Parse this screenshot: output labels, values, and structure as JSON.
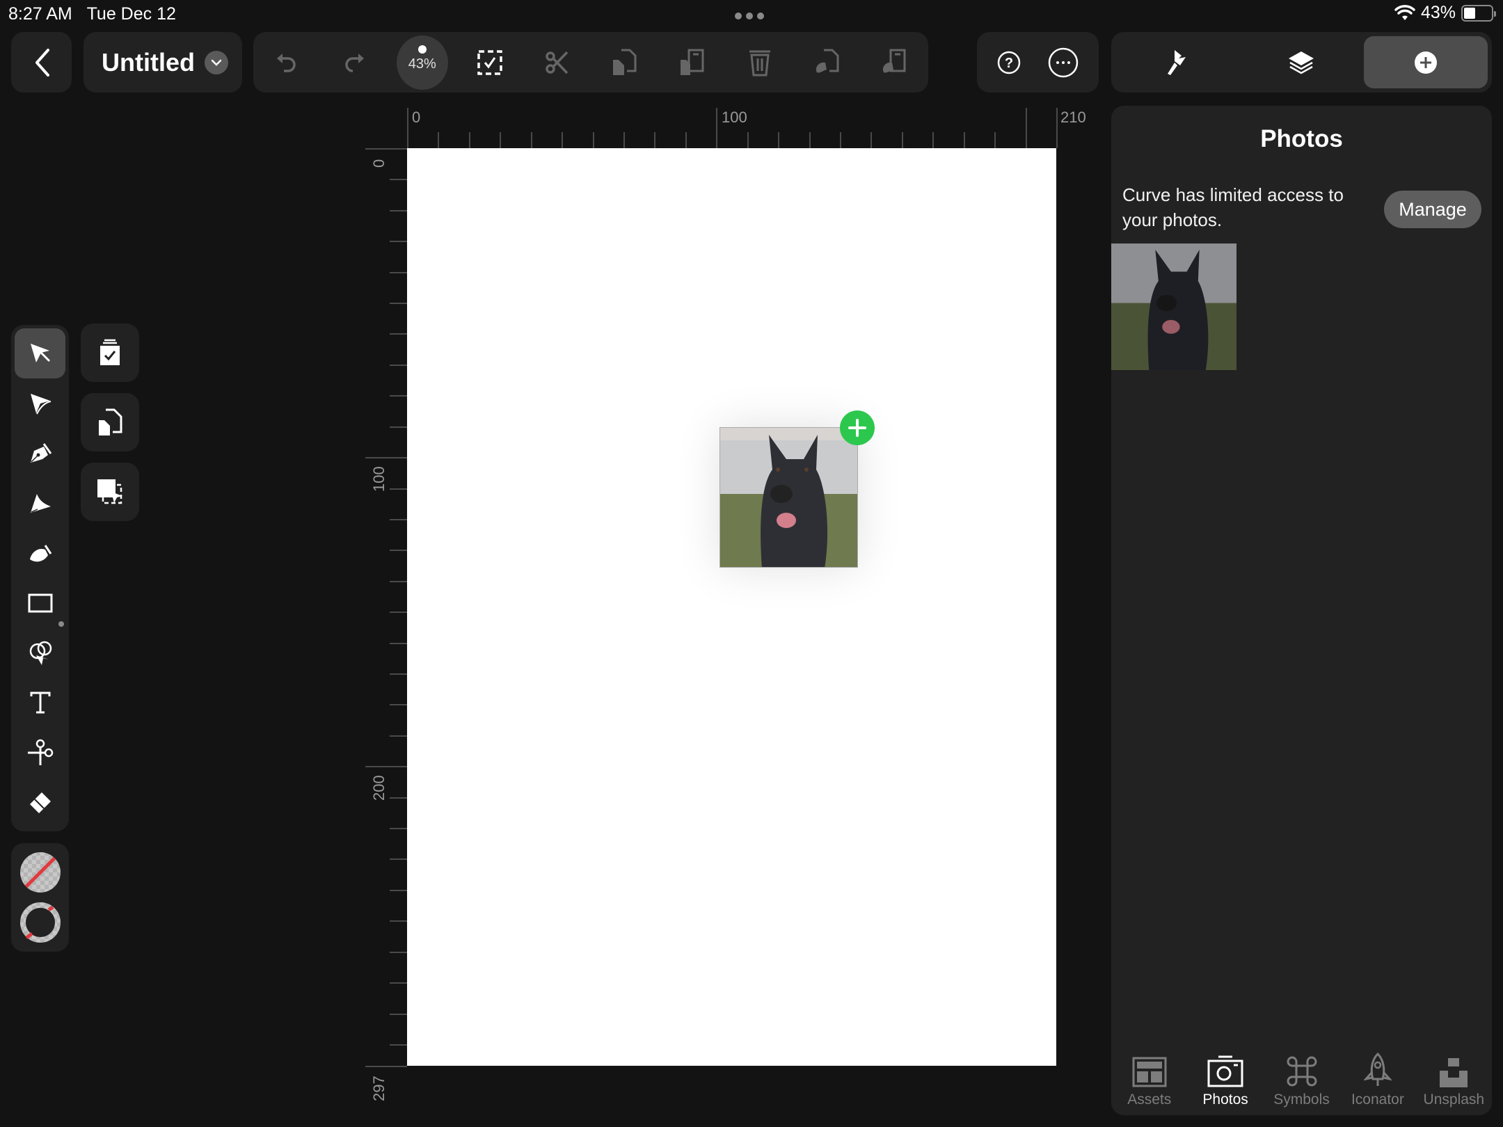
{
  "status_bar": {
    "time": "8:27 AM",
    "date": "Tue Dec 12",
    "battery_percent": "43%",
    "battery_level": 0.43,
    "icons": [
      "wifi-icon",
      "battery-icon"
    ]
  },
  "header": {
    "back_icon": "chevron-left-icon",
    "document_title": "Untitled",
    "title_menu_icon": "chevron-down-icon"
  },
  "toolbar": {
    "zoom_level": "43%",
    "buttons": [
      {
        "name": "undo",
        "icon": "undo-icon",
        "enabled": false
      },
      {
        "name": "redo",
        "icon": "redo-icon",
        "enabled": false
      },
      {
        "name": "select-all",
        "icon": "select-all-icon",
        "enabled": true
      },
      {
        "name": "cut",
        "icon": "scissors-icon",
        "enabled": false
      },
      {
        "name": "copy",
        "icon": "copy-icon",
        "enabled": false
      },
      {
        "name": "paste",
        "icon": "paste-icon",
        "enabled": false
      },
      {
        "name": "delete",
        "icon": "trash-icon",
        "enabled": false
      },
      {
        "name": "copy-style",
        "icon": "copy-style-icon",
        "enabled": false
      },
      {
        "name": "paste-style",
        "icon": "paste-style-icon",
        "enabled": false
      }
    ],
    "help_icon": "help-icon",
    "more_icon": "more-icon"
  },
  "inspector_tabs": [
    {
      "name": "style",
      "icon": "paintbrush-icon",
      "active": false
    },
    {
      "name": "layers",
      "icon": "layers-icon",
      "active": false
    },
    {
      "name": "insert",
      "icon": "plus-circle-icon",
      "active": true
    }
  ],
  "rulers": {
    "horizontal_labels": [
      "0",
      "100",
      "210"
    ],
    "vertical_labels": [
      "0",
      "100",
      "200",
      "297"
    ]
  },
  "canvas": {
    "page_size": "210 x 297",
    "placed_image": "dog-photo",
    "add_badge_icon": "plus-icon",
    "add_badge_color": "#2cc84d"
  },
  "tools": [
    {
      "name": "select",
      "icon": "arrow-select-icon",
      "active": true
    },
    {
      "name": "direct-select",
      "icon": "node-select-icon",
      "active": false
    },
    {
      "name": "pen",
      "icon": "pen-nib-icon",
      "active": false
    },
    {
      "name": "bezigon",
      "icon": "bezigon-icon",
      "active": false
    },
    {
      "name": "brush",
      "icon": "brush-icon",
      "active": false
    },
    {
      "name": "rectangle",
      "icon": "rectangle-icon",
      "active": false
    },
    {
      "name": "lasso",
      "icon": "lasso-icon",
      "active": false
    },
    {
      "name": "text",
      "icon": "text-icon",
      "active": false
    },
    {
      "name": "knife",
      "icon": "knife-icon",
      "active": false
    },
    {
      "name": "eraser",
      "icon": "eraser-icon",
      "active": false
    }
  ],
  "quick_actions": [
    {
      "name": "paste",
      "icon": "clipboard-check-icon"
    },
    {
      "name": "duplicate",
      "icon": "duplicate-icon"
    },
    {
      "name": "select-same",
      "icon": "select-same-icon"
    }
  ],
  "colors": {
    "fill": "none",
    "stroke": "none",
    "none_indicator": "#e0393e"
  },
  "right_panel": {
    "title": "Photos",
    "access_message": "Curve has limited access to your photos.",
    "manage_label": "Manage",
    "photos": [
      "dog-photo"
    ],
    "bottom_tabs": [
      {
        "label": "Assets",
        "icon": "assets-icon",
        "active": false
      },
      {
        "label": "Photos",
        "icon": "camera-icon",
        "active": true
      },
      {
        "label": "Symbols",
        "icon": "command-icon",
        "active": false
      },
      {
        "label": "Iconator",
        "icon": "rocket-icon",
        "active": false
      },
      {
        "label": "Unsplash",
        "icon": "unsplash-icon",
        "active": false
      }
    ]
  }
}
